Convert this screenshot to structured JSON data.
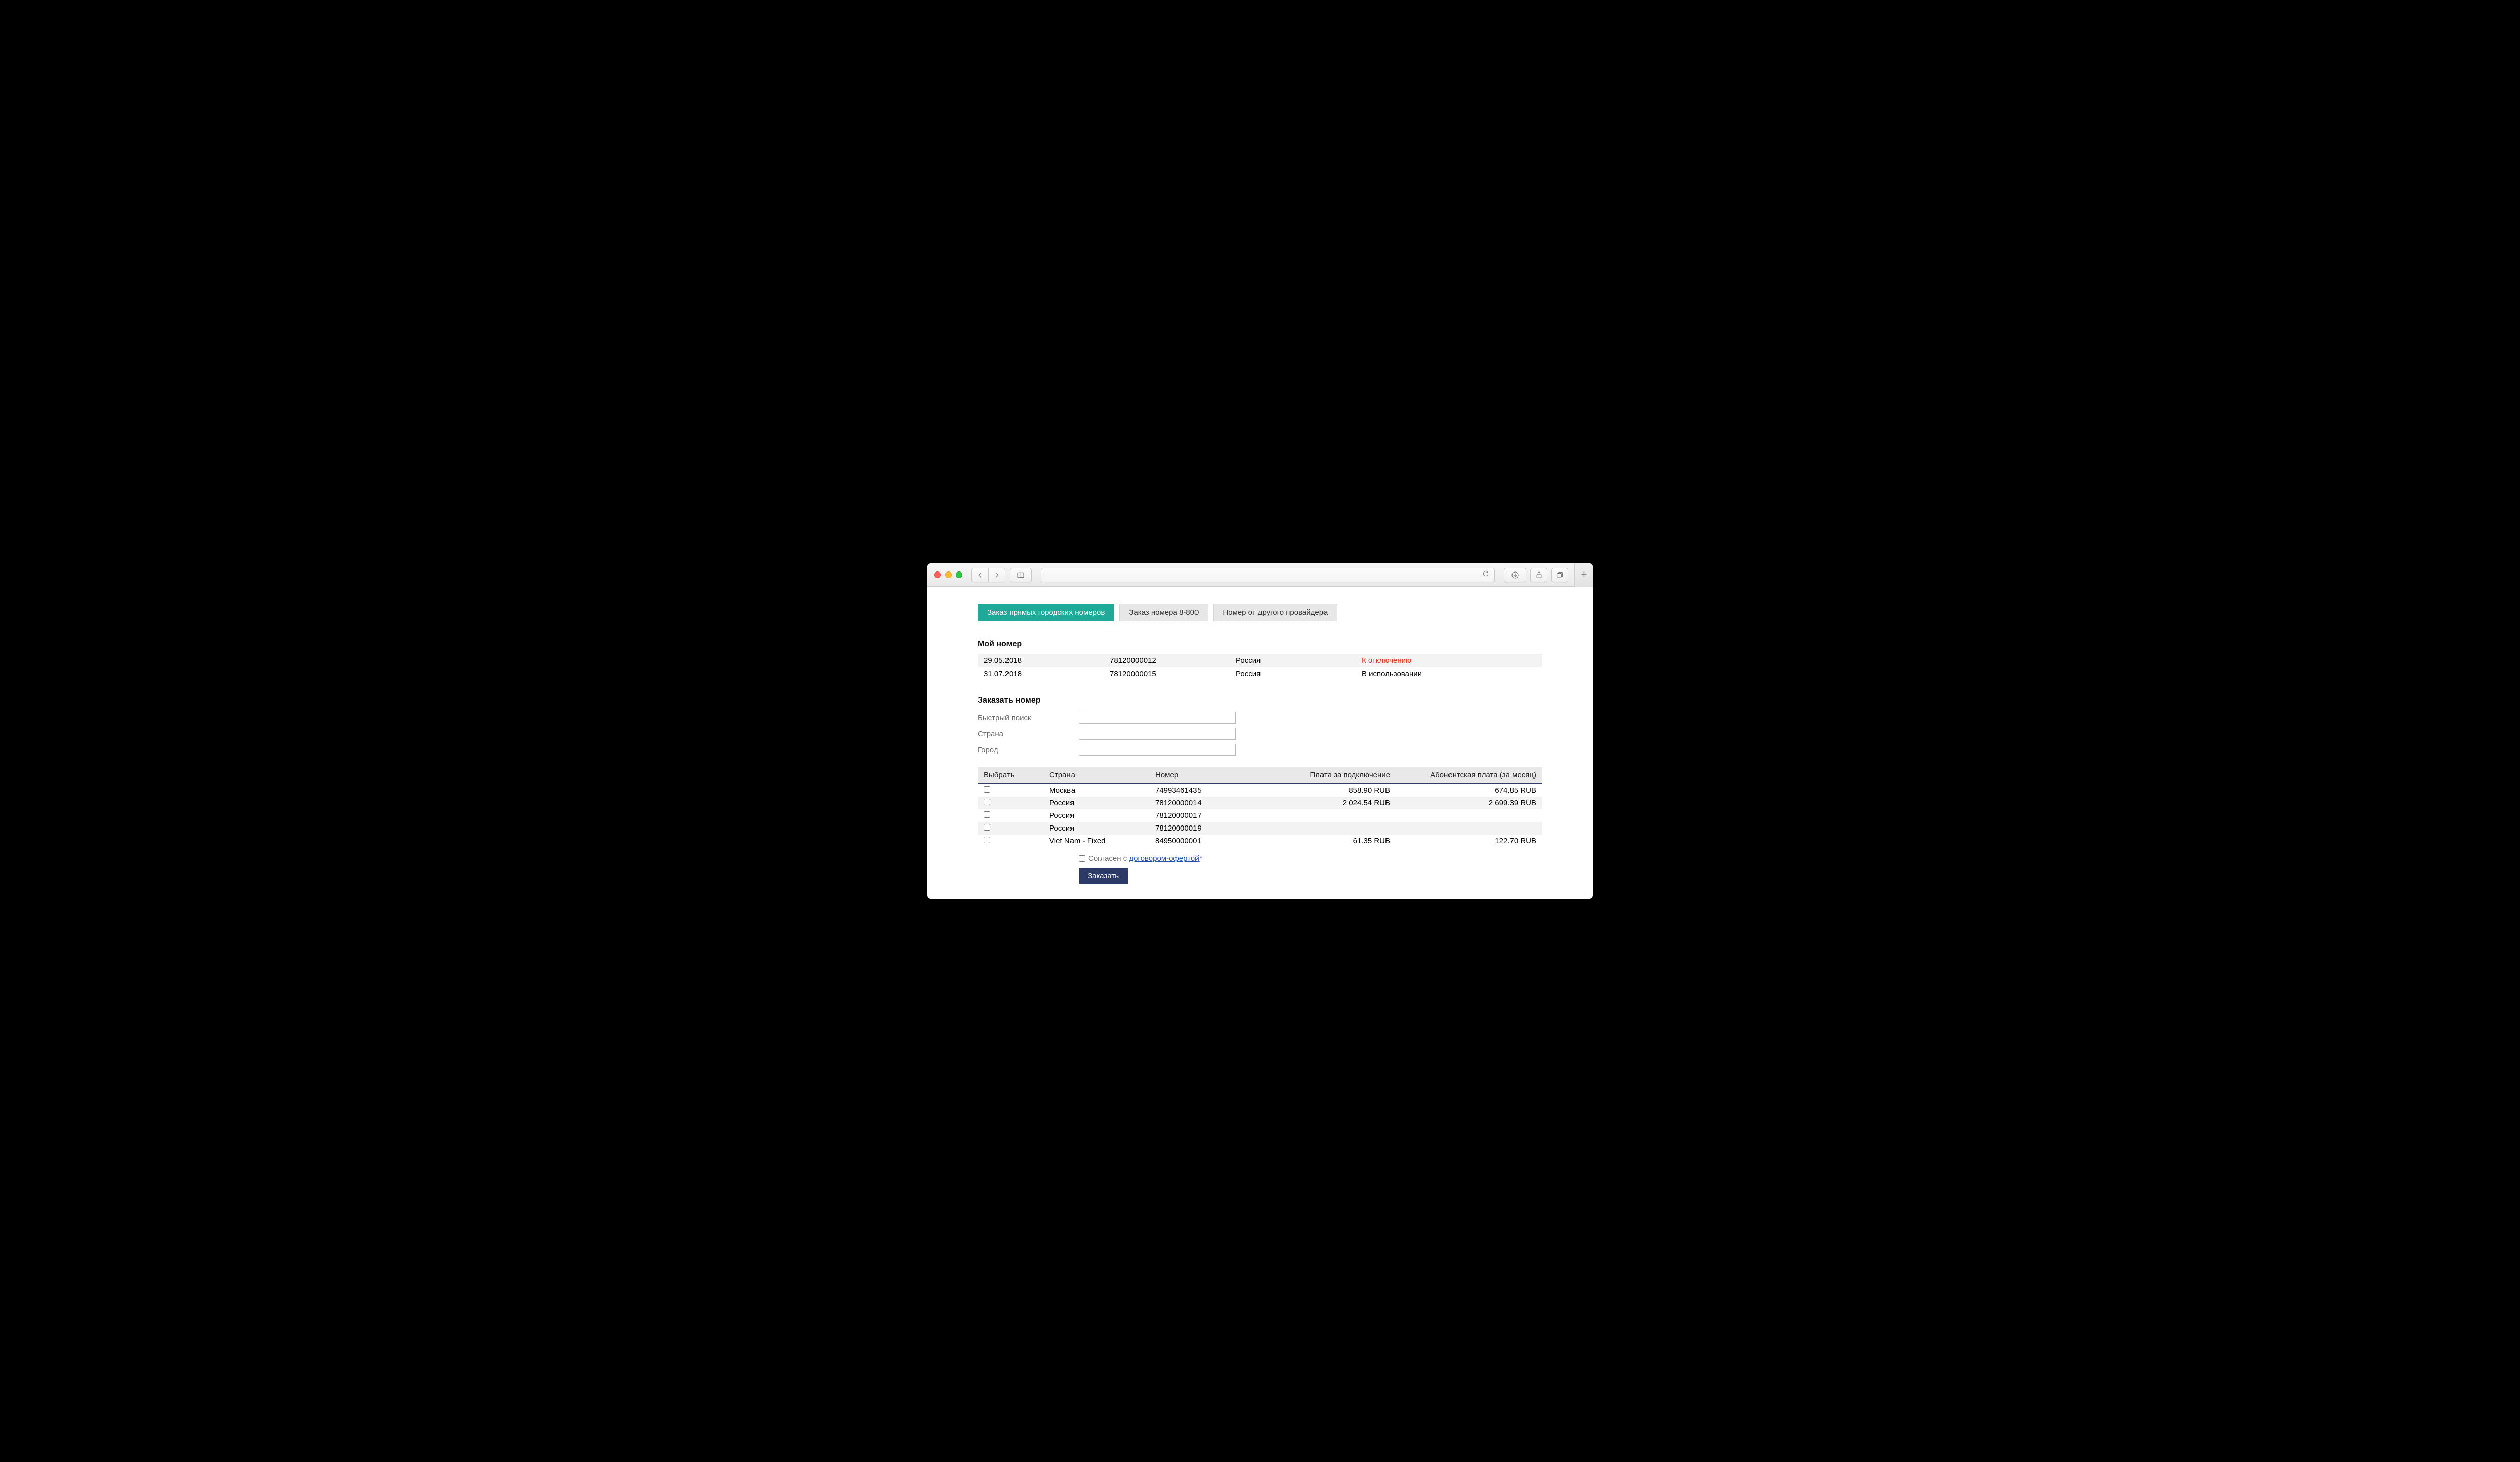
{
  "tabs": {
    "direct": "Заказ прямых городских номеров",
    "tollfree": "Заказ номера 8-800",
    "other": "Номер от другого провайдера"
  },
  "sections": {
    "my_number": "Мой номер",
    "order_number": "Заказать номер"
  },
  "my_numbers": [
    {
      "date": "29.05.2018",
      "number": "78120000012",
      "country": "Россия",
      "status": "К отключению",
      "status_color": "red"
    },
    {
      "date": "31.07.2018",
      "number": "78120000015",
      "country": "Россия",
      "status": "В использовании",
      "status_color": ""
    }
  ],
  "form": {
    "quick_search": "Быстрый поиск",
    "country": "Страна",
    "city": "Город"
  },
  "avail_headers": {
    "select": "Выбрать",
    "country": "Страна",
    "number": "Номер",
    "setup_fee": "Плата за подключение",
    "monthly_fee": "Абонентская плата (за месяц)"
  },
  "available": [
    {
      "country": "Москва",
      "number": "74993461435",
      "setup": "858.90 RUB",
      "monthly": "674.85 RUB"
    },
    {
      "country": "Россия",
      "number": "78120000014",
      "setup": "2 024.54 RUB",
      "monthly": "2 699.39 RUB"
    },
    {
      "country": "Россия",
      "number": "78120000017",
      "setup": "",
      "monthly": ""
    },
    {
      "country": "Россия",
      "number": "78120000019",
      "setup": "",
      "monthly": ""
    },
    {
      "country": "Viet Nam - Fixed",
      "number": "84950000001",
      "setup": "61.35 RUB",
      "monthly": "122.70 RUB"
    }
  ],
  "agreement": {
    "prefix": "Согласен с ",
    "link": "договором-офертой",
    "suffix": "*"
  },
  "order_button": "Заказать"
}
